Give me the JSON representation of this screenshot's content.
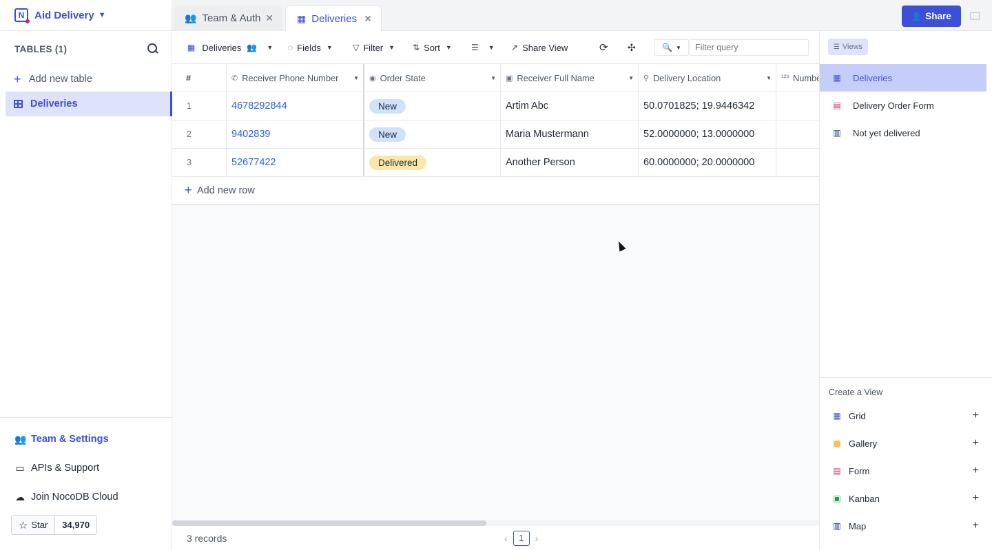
{
  "project": {
    "name": "Aid Delivery",
    "logo_letter": "N"
  },
  "sidebar": {
    "tables_title": "TABLES (1)",
    "add_table": "Add new table",
    "tables": [
      {
        "label": "Deliveries"
      }
    ],
    "bottom": {
      "team": "Team & Settings",
      "apis": "APIs & Support",
      "cloud": "Join NocoDB Cloud",
      "star": "Star",
      "star_count": "34,970"
    }
  },
  "tabs": [
    {
      "label": "Team & Auth",
      "active": false
    },
    {
      "label": "Deliveries",
      "active": true
    }
  ],
  "share_label": "Share",
  "toolbar": {
    "view_name": "Deliveries",
    "fields": "Fields",
    "filter": "Filter",
    "sort": "Sort",
    "share_view": "Share View",
    "filter_placeholder": "Filter query"
  },
  "grid": {
    "columns": [
      {
        "label": "#"
      },
      {
        "label": "Receiver Phone Number",
        "icon": "phone-icon"
      },
      {
        "label": "Order State",
        "icon": "single-select-icon"
      },
      {
        "label": "Receiver Full Name",
        "icon": "text-icon"
      },
      {
        "label": "Delivery Location",
        "icon": "location-icon"
      },
      {
        "label": "Numbe",
        "icon": "number-icon"
      }
    ],
    "rows": [
      {
        "num": "1",
        "phone": "4678292844",
        "state": "New",
        "name": "Artim Abc",
        "location": "50.0701825; 19.9446342"
      },
      {
        "num": "2",
        "phone": "9402839",
        "state": "New",
        "name": "Maria Mustermann",
        "location": "52.0000000; 13.0000000"
      },
      {
        "num": "3",
        "phone": "52677422",
        "state": "Delivered",
        "name": "Another Person",
        "location": "60.0000000; 20.0000000"
      }
    ],
    "add_row": "Add new row"
  },
  "footer": {
    "records": "3 records",
    "page": "1"
  },
  "right_panel": {
    "views_label": "Views",
    "views": [
      {
        "label": "Deliveries",
        "type": "grid",
        "active": true
      },
      {
        "label": "Delivery Order Form",
        "type": "form",
        "active": false
      },
      {
        "label": "Not yet delivered",
        "type": "map",
        "active": false
      }
    ],
    "create_title": "Create a View",
    "create": [
      {
        "label": "Grid",
        "icon": "grid-icon",
        "color": "#3b4fd8"
      },
      {
        "label": "Gallery",
        "icon": "gallery-icon",
        "color": "#f59e0b"
      },
      {
        "label": "Form",
        "icon": "form-icon",
        "color": "#db2777"
      },
      {
        "label": "Kanban",
        "icon": "kanban-icon",
        "color": "#16a34a"
      },
      {
        "label": "Map",
        "icon": "map-icon",
        "color": "#1e3a8a"
      }
    ]
  },
  "colors": {
    "accent": "#3b4fd8",
    "pill_new": "#cfe2fb",
    "pill_delivered": "#fde7a7"
  }
}
